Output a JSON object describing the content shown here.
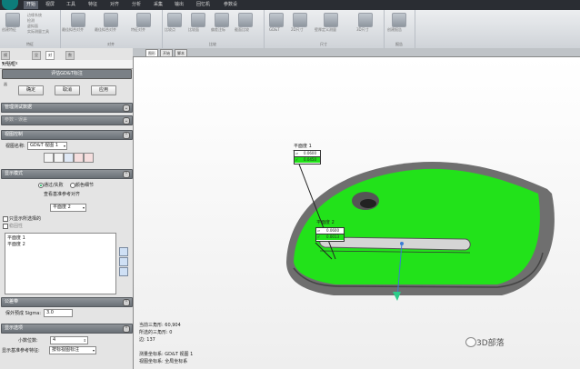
{
  "menubar": {
    "tabs": [
      "开始",
      "视屏",
      "工具",
      "特征",
      "对齐",
      "分析",
      "采集",
      "输出",
      "回忆机",
      "参数设"
    ],
    "active_index": 0
  },
  "ribbon": {
    "groups": [
      {
        "label": "特征",
        "buttons": [
          "创建特征"
        ],
        "options": [
          "边缘系统",
          "检测",
          "虚拟面",
          "实际测量工具"
        ]
      },
      {
        "label": "对齐",
        "buttons": [
          "最佳拟合对齐",
          "最佳拟合对齐",
          "特征对齐"
        ]
      },
      {
        "label": "比较",
        "buttons": [
          "比较点",
          "比较面",
          "偏差注标",
          "截面比较"
        ]
      },
      {
        "label": "尺寸",
        "buttons": [
          "GD&T",
          "2D尺寸",
          "壁厚定义测量",
          "3D尺寸"
        ]
      },
      {
        "label": "报告",
        "buttons": [
          "创建报告"
        ]
      }
    ]
  },
  "left_panel": {
    "tabs": [
      "模型管理器",
      "显示",
      "对话框",
      "数据库"
    ],
    "active_tab": 2,
    "title": "对话框",
    "controls": "▾ 4 × x",
    "header_text": "评估GD&T标注",
    "buttons": {
      "ok": "确定",
      "cancel": "取消",
      "apply": "应用"
    },
    "sections": {
      "data": "管理测试数据",
      "extra": "参数 - 误差",
      "view": "视图控制",
      "display": "显示模式",
      "tolerance": "公差带",
      "display_options": "显示选项"
    },
    "view_label": "视图名称:",
    "view_value": "GD&T 视图 1",
    "mode_radio_1": "通过/失败",
    "mode_radio_2": "颜色细节",
    "mode_line": "查看基准参考对齐",
    "mode_select": "平面度 2",
    "checkbox_1": "只显示所选择的",
    "checkbox_2": "稳固性",
    "list_items": [
      "平面度 1",
      "平面度 2"
    ],
    "sigma_label": "保外预成 Sigma:",
    "sigma_value": "3.0",
    "decimals_label": "小数位数:",
    "decimals_value": "4",
    "ref_label": "显示基准参考特征:",
    "ref_value": "按标视图标注"
  },
  "viewport": {
    "tabs": [
      "图形",
      "开始",
      "脚本"
    ],
    "active_tab": 0,
    "callout1": {
      "title": "平面度 1",
      "tolerance": "0.0600",
      "measured": "0.0450"
    },
    "callout2": {
      "title": "平面度 2",
      "tolerance": "0.0600",
      "measured": "0.0013"
    },
    "status": {
      "triangles": "当前三角形: 60,904",
      "selected": "所选的三角形: 0",
      "edges": "边: 137",
      "coord1": "测量坐标系: GD&T 视图 1",
      "coord2": "视图坐标系: 全局坐标系"
    }
  },
  "watermark": "3D部落",
  "colors": {
    "pass_green": "#22e21a",
    "menu_bg": "#2a2d33",
    "section_bg": "#7a8086"
  }
}
